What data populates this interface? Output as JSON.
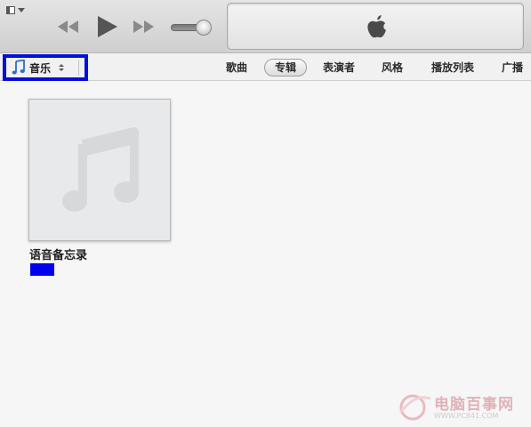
{
  "toolbar": {
    "icons": {
      "menu": "sidebar-menu-icon",
      "previous": "rewind-icon",
      "play": "play-icon",
      "next": "fast-forward-icon",
      "volume": "volume-slider",
      "logo": "apple-logo-icon"
    },
    "volume_level": 0.75
  },
  "navbar": {
    "source": {
      "label": "音乐",
      "icon": "music-note-icon"
    },
    "tabs": [
      {
        "label": "歌曲",
        "active": false
      },
      {
        "label": "专辑",
        "active": true
      },
      {
        "label": "表演者",
        "active": false
      },
      {
        "label": "风格",
        "active": false
      },
      {
        "label": "播放列表",
        "active": false
      },
      {
        "label": "广播",
        "active": false
      }
    ]
  },
  "content": {
    "albums": [
      {
        "title": "语音备忘录",
        "artwork_icon": "music-note-placeholder-icon"
      }
    ]
  },
  "watermark": {
    "text": "电脑百事网",
    "url": "WWW.PC841.COM"
  },
  "colors": {
    "highlight": "#0010d8",
    "marker": "#0000ee"
  }
}
